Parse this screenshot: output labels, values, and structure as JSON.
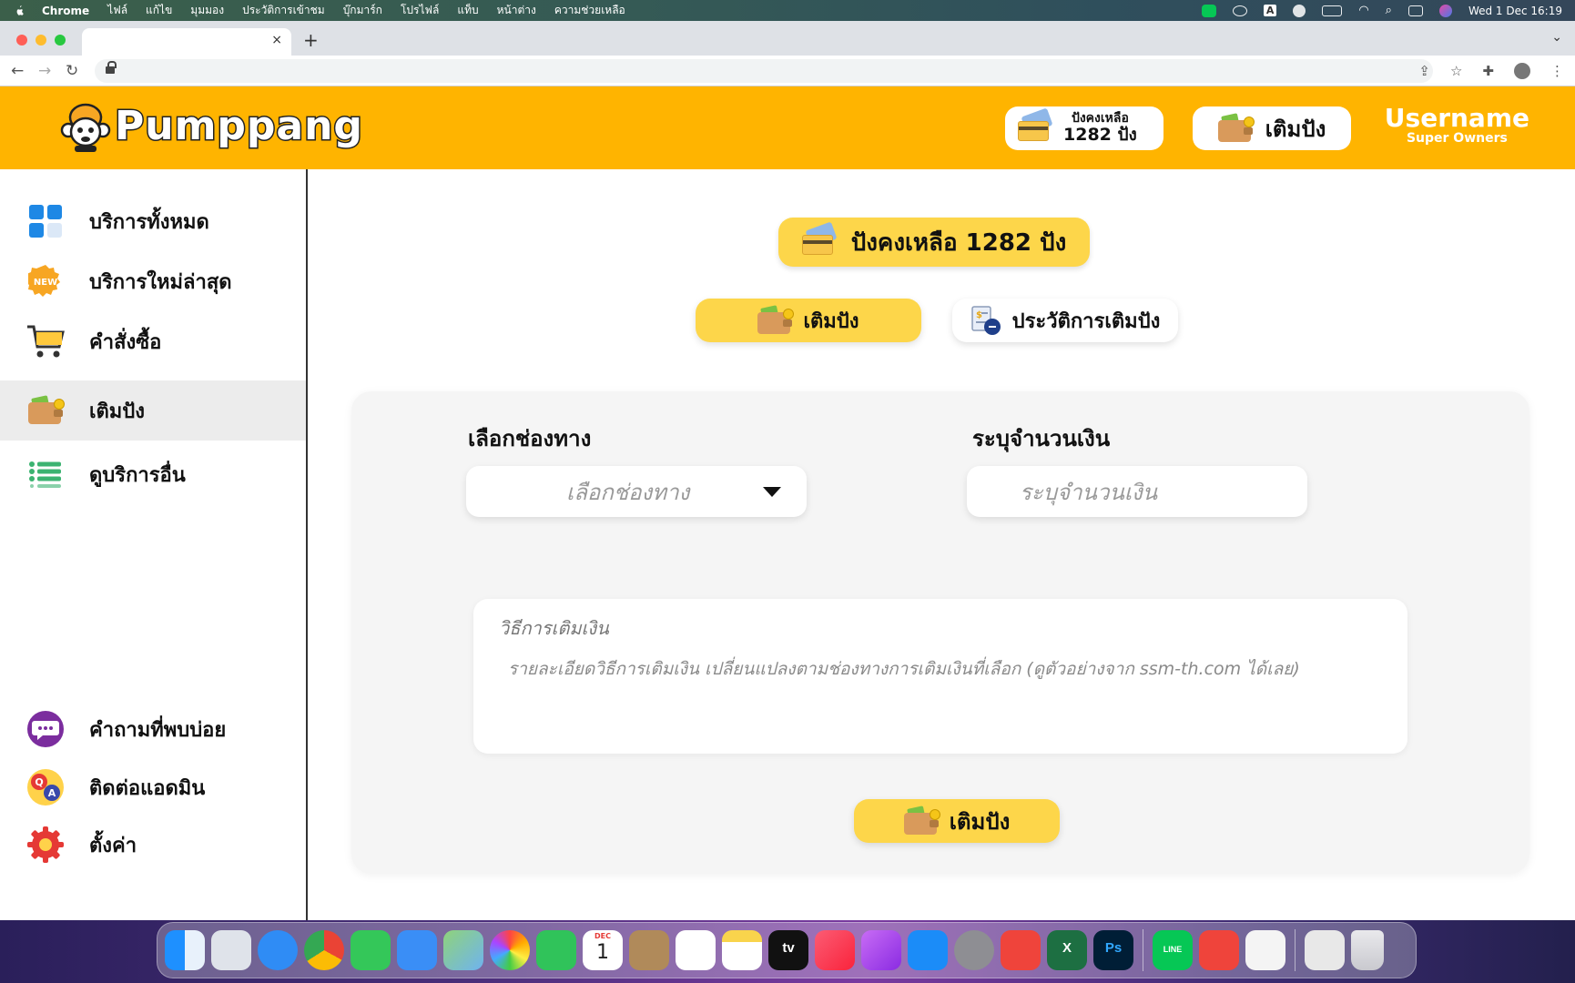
{
  "menubar": {
    "app": "Chrome",
    "items": [
      "ไฟล์",
      "แก้ไข",
      "มุมมอง",
      "ประวัติการเข้าชม",
      "บุ๊กมาร์ก",
      "โปรไฟล์",
      "แท็บ",
      "หน้าต่าง",
      "ความช่วยเหลือ"
    ],
    "clock": "Wed 1 Dec  16:19",
    "input_source": "A"
  },
  "browser": {
    "tab_close": "×",
    "new_tab": "+"
  },
  "header": {
    "logo_text": "Pumppang",
    "balance_label": "ปังคงเหลือ",
    "balance_value": "1282 ปัง",
    "topup_label": "เติมปัง",
    "username": "Username",
    "role": "Super Owners",
    "colors": {
      "brand": "#ffb400",
      "accent": "#fdd64a"
    }
  },
  "sidebar": {
    "items": [
      {
        "label": "บริการทั้งหมด",
        "icon": "grid-icon"
      },
      {
        "label": "บริการใหม่ล่าสุด",
        "icon": "new-badge-icon",
        "badge": "NEW"
      },
      {
        "label": "คำสั่งซื้อ",
        "icon": "cart-icon"
      },
      {
        "label": "เติมปัง",
        "icon": "wallet-icon",
        "active": true
      },
      {
        "label": "ดูบริการอื่น",
        "icon": "list-icon"
      }
    ],
    "bottom_items": [
      {
        "label": "คำถามที่พบบ่อย",
        "icon": "chat-icon"
      },
      {
        "label": "ติดต่อแอดมิน",
        "icon": "qa-icon"
      },
      {
        "label": "ตั้งค่า",
        "icon": "gear-icon"
      }
    ]
  },
  "main": {
    "balance_banner": "ปังคงเหลือ  1282 ปัง",
    "tabs": [
      {
        "label": "เติมปัง",
        "active": true
      },
      {
        "label": "ประวัติการเติมปัง",
        "active": false
      }
    ],
    "form": {
      "channel_label": "เลือกช่องทาง",
      "channel_placeholder": "เลือกช่องทาง",
      "amount_label": "ระบุจำนวนเงิน",
      "amount_placeholder": "ระบุจำนวนเงิน",
      "method_title": "วิธีการเติมเงิน",
      "method_body": "รายละเอียดวิธีการเติมเงิน เปลี่ยนแปลงตามช่องทางการเติมเงินที่เลือก (ดูตัวอย่างจาก ssm-th.com ได้เลย)",
      "submit_label": "เติมปัง"
    }
  },
  "dock": {
    "apps": [
      "finder",
      "launchpad",
      "safari",
      "chrome",
      "messages",
      "mail",
      "maps",
      "photos",
      "facetime",
      "calendar",
      "contacts",
      "reminders",
      "notes",
      "tv",
      "music",
      "podcasts",
      "app-store",
      "system-preferences",
      "anydesk",
      "excel",
      "photoshop",
      "line",
      "anydesk-2",
      "textedit",
      "preview",
      "trash"
    ],
    "calendar_month": "DEC",
    "calendar_day": "1",
    "tv_label": "tv",
    "excel_label": "X",
    "photoshop_label": "Ps",
    "line_label": "LINE"
  }
}
